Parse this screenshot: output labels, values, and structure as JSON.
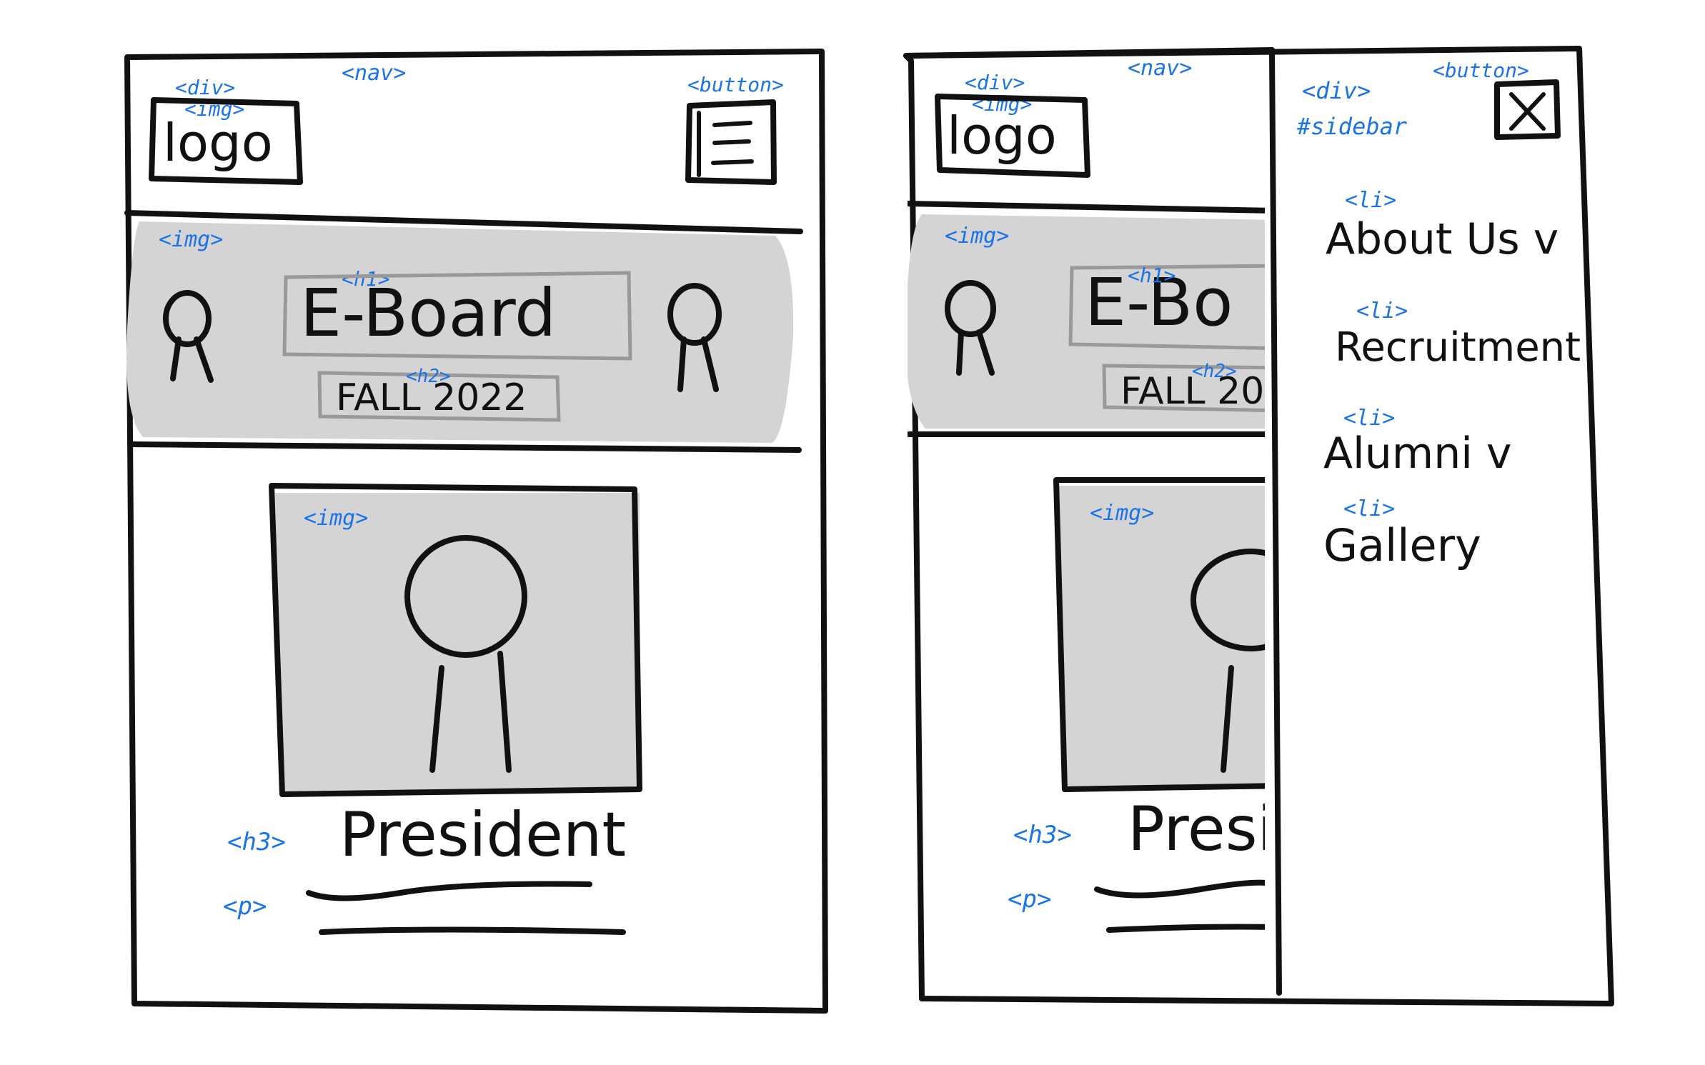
{
  "frames": [
    {
      "nav_tag": "<nav>",
      "div_tag": "<div>",
      "img_tag": "<img>",
      "logo_text": "logo",
      "button_tag": "<button>",
      "menu_icon": "hamburger-icon",
      "hero_tag": "<img>",
      "h1_tag": "<h1>",
      "h1_text": "E-Board",
      "h2_tag": "<h2>",
      "h2_text": "FALL 2022",
      "photo_tag": "<img>",
      "h3_tag": "<h3>",
      "h3_text": "President",
      "p_tag": "<p>"
    },
    {
      "nav_tag": "<nav>",
      "div_tag": "<div>",
      "img_tag": "<img>",
      "logo_text": "logo",
      "hero_tag": "<img>",
      "h1_tag": "<h1>",
      "h1_text": "E-Bo",
      "h2_tag": "<h2>",
      "h2_text": "FALL 20",
      "photo_tag": "<img>",
      "h3_tag": "<h3>",
      "h3_text": "Presi",
      "p_tag": "<p>"
    }
  ],
  "sidebar": {
    "div_tag": "<div>",
    "id_label": "#sidebar",
    "button_tag": "<button>",
    "close_icon": "close-icon",
    "li_tag": "<li>",
    "items": [
      "About Us v",
      "Recruitment",
      "Alumni v",
      "Gallery"
    ]
  },
  "colors": {
    "annotation": "#1a73e8",
    "shade": "#d4d4d4",
    "ink": "#111111"
  }
}
